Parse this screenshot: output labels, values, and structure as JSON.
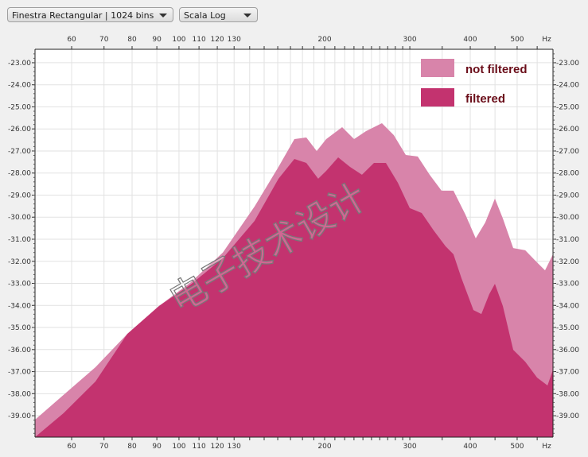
{
  "toolbar": {
    "window_select": "Finestra Rectangular | 1024 bins",
    "scale_select": "Scala Log"
  },
  "watermark": "电子技术设计",
  "chart_data": {
    "type": "area",
    "title": "",
    "xlabel": "Hz",
    "ylabel": "",
    "xscale": "log",
    "xlim": [
      50.4,
      593
    ],
    "ylim": [
      -39.97,
      -22.39
    ],
    "x_ticks": [
      60,
      70,
      80,
      90,
      100,
      110,
      120,
      130,
      200,
      300,
      400,
      500
    ],
    "x_unit_label": "Hz",
    "y_ticks": [
      "-23.00",
      "-24.00",
      "-25.00",
      "-26.00",
      "-27.00",
      "-28.00",
      "-29.00",
      "-30.00",
      "-31.00",
      "-32.00",
      "-33.00",
      "-34.00",
      "-35.00",
      "-36.00",
      "-37.00",
      "-38.00",
      "-39.00"
    ],
    "grid": true,
    "legend_position": "top-right",
    "series": [
      {
        "name": "not filtered",
        "color": "#d884aa",
        "x": [
          50.4,
          57.7,
          67.2,
          78.2,
          90.9,
          105.8,
          123.2,
          143.3,
          160.6,
          173.2,
          183.3,
          192.6,
          201.5,
          217.4,
          230.1,
          243.5,
          262.7,
          278.0,
          294.3,
          311.5,
          329.7,
          348.9,
          369.3,
          390.9,
          410.6,
          429.7,
          449.8,
          467.1,
          490.7,
          519.5,
          549.7,
          571.0,
          593.1
        ],
        "y": [
          -39.18,
          -38.06,
          -36.8,
          -35.29,
          -34.03,
          -32.95,
          -31.61,
          -29.52,
          -27.72,
          -26.46,
          -26.39,
          -27.0,
          -26.46,
          -25.92,
          -26.46,
          -26.1,
          -25.74,
          -26.28,
          -27.18,
          -27.25,
          -28.08,
          -28.8,
          -28.8,
          -29.88,
          -30.96,
          -30.24,
          -29.16,
          -30.06,
          -31.4,
          -31.5,
          -32.05,
          -32.41,
          -31.68
        ]
      },
      {
        "name": "filtered",
        "color": "#c3336f",
        "x": [
          50.4,
          57.7,
          67.2,
          78.2,
          90.9,
          105.8,
          123.2,
          143.3,
          160.6,
          173.2,
          183.3,
          194.0,
          201.5,
          213.3,
          225.7,
          238.9,
          252.9,
          267.7,
          283.4,
          299.9,
          317.5,
          336.0,
          355.6,
          369.3,
          383.6,
          406.0,
          421.7,
          437.9,
          449.8,
          467.1,
          490.7,
          519.5,
          549.7,
          577.6,
          593.1
        ],
        "y": [
          -39.97,
          -38.89,
          -37.45,
          -35.29,
          -34.03,
          -33.05,
          -31.86,
          -30.17,
          -28.26,
          -27.36,
          -27.54,
          -28.26,
          -27.9,
          -27.29,
          -27.72,
          -28.08,
          -27.54,
          -27.54,
          -28.44,
          -29.59,
          -29.81,
          -30.6,
          -31.32,
          -31.68,
          -32.77,
          -34.21,
          -34.39,
          -33.49,
          -33.02,
          -34.03,
          -36.01,
          -36.55,
          -37.27,
          -37.63,
          -36.91
        ]
      }
    ]
  }
}
